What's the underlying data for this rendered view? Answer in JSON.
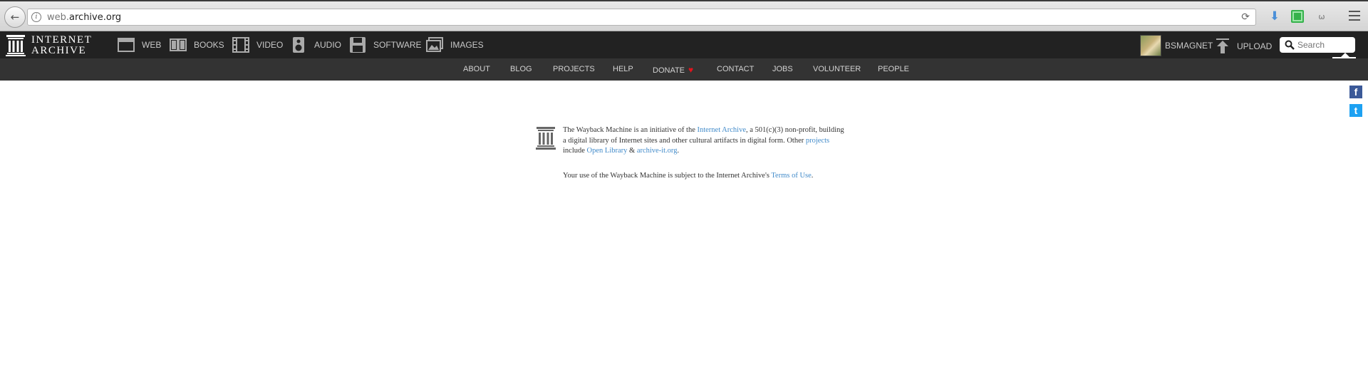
{
  "browser": {
    "url_subdomain": "web.",
    "url_domain": "archive.org",
    "back_symbol": "←",
    "reload_symbol": "⟳",
    "ghost_ext_symbol": "ω",
    "download_symbol": "⬇"
  },
  "topnav": {
    "logo_line1": "INTERNET",
    "logo_line2": "ARCHIVE",
    "tabs": [
      {
        "label": "WEB",
        "icon": "web-icon"
      },
      {
        "label": "BOOKS",
        "icon": "books-icon"
      },
      {
        "label": "VIDEO",
        "icon": "video-icon"
      },
      {
        "label": "AUDIO",
        "icon": "audio-icon"
      },
      {
        "label": "SOFTWARE",
        "icon": "software-icon"
      },
      {
        "label": "IMAGES",
        "icon": "images-icon"
      }
    ],
    "username": "BSMAGNET",
    "upload_label": "UPLOAD",
    "search_placeholder": "Search"
  },
  "subnav": {
    "items": [
      "ABOUT",
      "BLOG",
      "PROJECTS",
      "HELP",
      "DONATE",
      "CONTACT",
      "JOBS",
      "VOLUNTEER",
      "PEOPLE"
    ],
    "heart": "♥"
  },
  "social": {
    "facebook": "f",
    "twitter": "t"
  },
  "content": {
    "p1_a": "The Wayback Machine is an initiative of the ",
    "p1_link": "Internet Archive",
    "p1_b": ", a 501(c)(3) non-profit, building a digital library of Internet sites and other cultural artifacts in digital form. Other ",
    "p1_link2": "projects",
    "p1_c": " include ",
    "p1_link3": "Open Library",
    "p1_d": " & ",
    "p1_link4": "archive-it.org",
    "p1_e": ".",
    "p2_a": "Your use of the Wayback Machine is subject to the Internet Archive's ",
    "p2_link": "Terms of Use",
    "p2_b": "."
  },
  "colors": {
    "nav_bg": "#222222",
    "subnav_bg": "#333333",
    "link": "#428bca",
    "heart": "#e3141d"
  }
}
